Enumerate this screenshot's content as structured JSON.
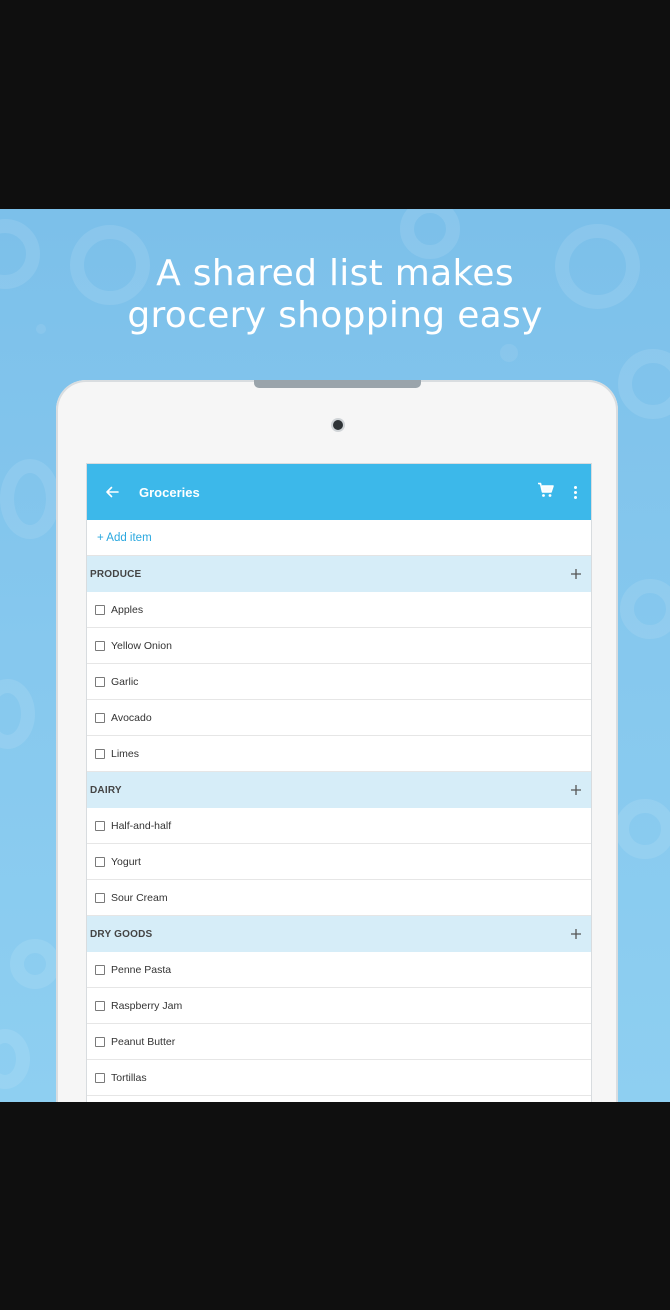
{
  "headline": {
    "line1": "A shared list makes",
    "line2": "grocery shopping easy"
  },
  "app": {
    "title": "Groceries",
    "back_icon": "arrow-left-icon",
    "cart_icon": "cart-icon",
    "menu_icon": "more-vert-icon",
    "accent_color": "#3cb8ea",
    "add_item_label": "+ Add item"
  },
  "sections": [
    {
      "name": "PRODUCE",
      "items": [
        "Apples",
        "Yellow Onion",
        "Garlic",
        "Avocado",
        "Limes"
      ]
    },
    {
      "name": "DAIRY",
      "items": [
        "Half-and-half",
        "Yogurt",
        "Sour Cream"
      ]
    },
    {
      "name": "DRY GOODS",
      "items": [
        "Penne Pasta",
        "Raspberry Jam",
        "Peanut Butter",
        "Tortillas"
      ]
    }
  ]
}
